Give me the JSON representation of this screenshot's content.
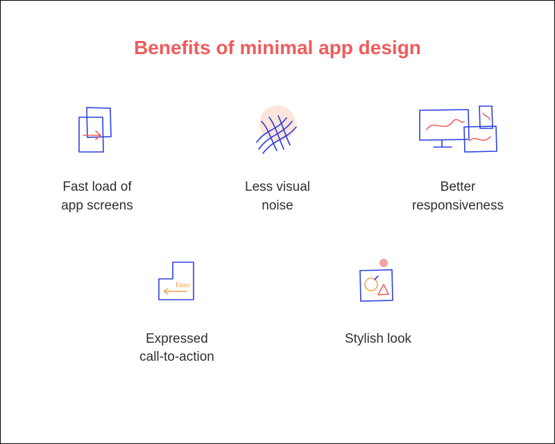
{
  "title": "Benefits of minimal\napp design",
  "items": [
    {
      "label": "Fast load of\napp screens"
    },
    {
      "label": "Less visual\nnoise"
    },
    {
      "label": "Better\nresponsiveness"
    },
    {
      "label": "Expressed\ncall-to-action"
    },
    {
      "label": "Stylish look"
    }
  ],
  "enter_text": "Enter",
  "colors": {
    "accent": "#f15b5b",
    "stroke": "#2a3fe0",
    "text": "#2e2f33",
    "peach": "#fde5dc",
    "orange": "#f7a24a"
  }
}
